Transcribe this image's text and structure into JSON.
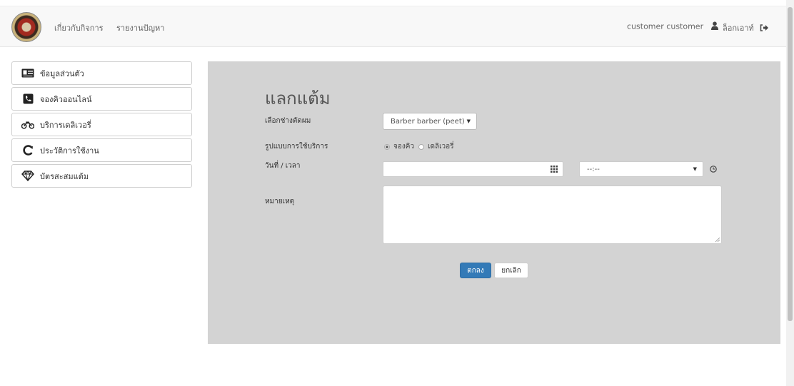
{
  "nav": {
    "links": [
      "เกี่ยวกับกิจการ",
      "รายงานปัญหา"
    ],
    "user_name": "customer customer",
    "logout_label": "ล็อกเอาท์"
  },
  "sidebar": {
    "items": [
      {
        "label": "ข้อมูลส่วนตัว",
        "icon": "id-card-icon"
      },
      {
        "label": "จองคิวออนไลน์",
        "icon": "phone-icon"
      },
      {
        "label": "บริการเดลิเวอรี่",
        "icon": "motorcycle-icon"
      },
      {
        "label": "ประวัติการใช้งาน",
        "icon": "history-icon"
      },
      {
        "label": "บัตรสะสมแต้ม",
        "icon": "diamond-icon"
      }
    ]
  },
  "form": {
    "title": "แลกแต้ม",
    "barber_label": "เลือกช่างตัดผม",
    "barber_value": "Barber barber (peet)",
    "service_label": "รูปแบบการใช้บริการ",
    "service_options": [
      "จองคิว",
      "เดลิเวอรี่"
    ],
    "service_selected": "จองคิว",
    "datetime_label": "วันที่ / เวลา",
    "date_value": "",
    "time_value": "--:--",
    "note_label": "หมายเหตุ",
    "note_value": "",
    "submit_label": "ตกลง",
    "cancel_label": "ยกเลิก"
  },
  "colors": {
    "primary": "#337ab7",
    "panel_bg": "#d3d3d3",
    "navbar_bg": "#f8f8f8"
  }
}
